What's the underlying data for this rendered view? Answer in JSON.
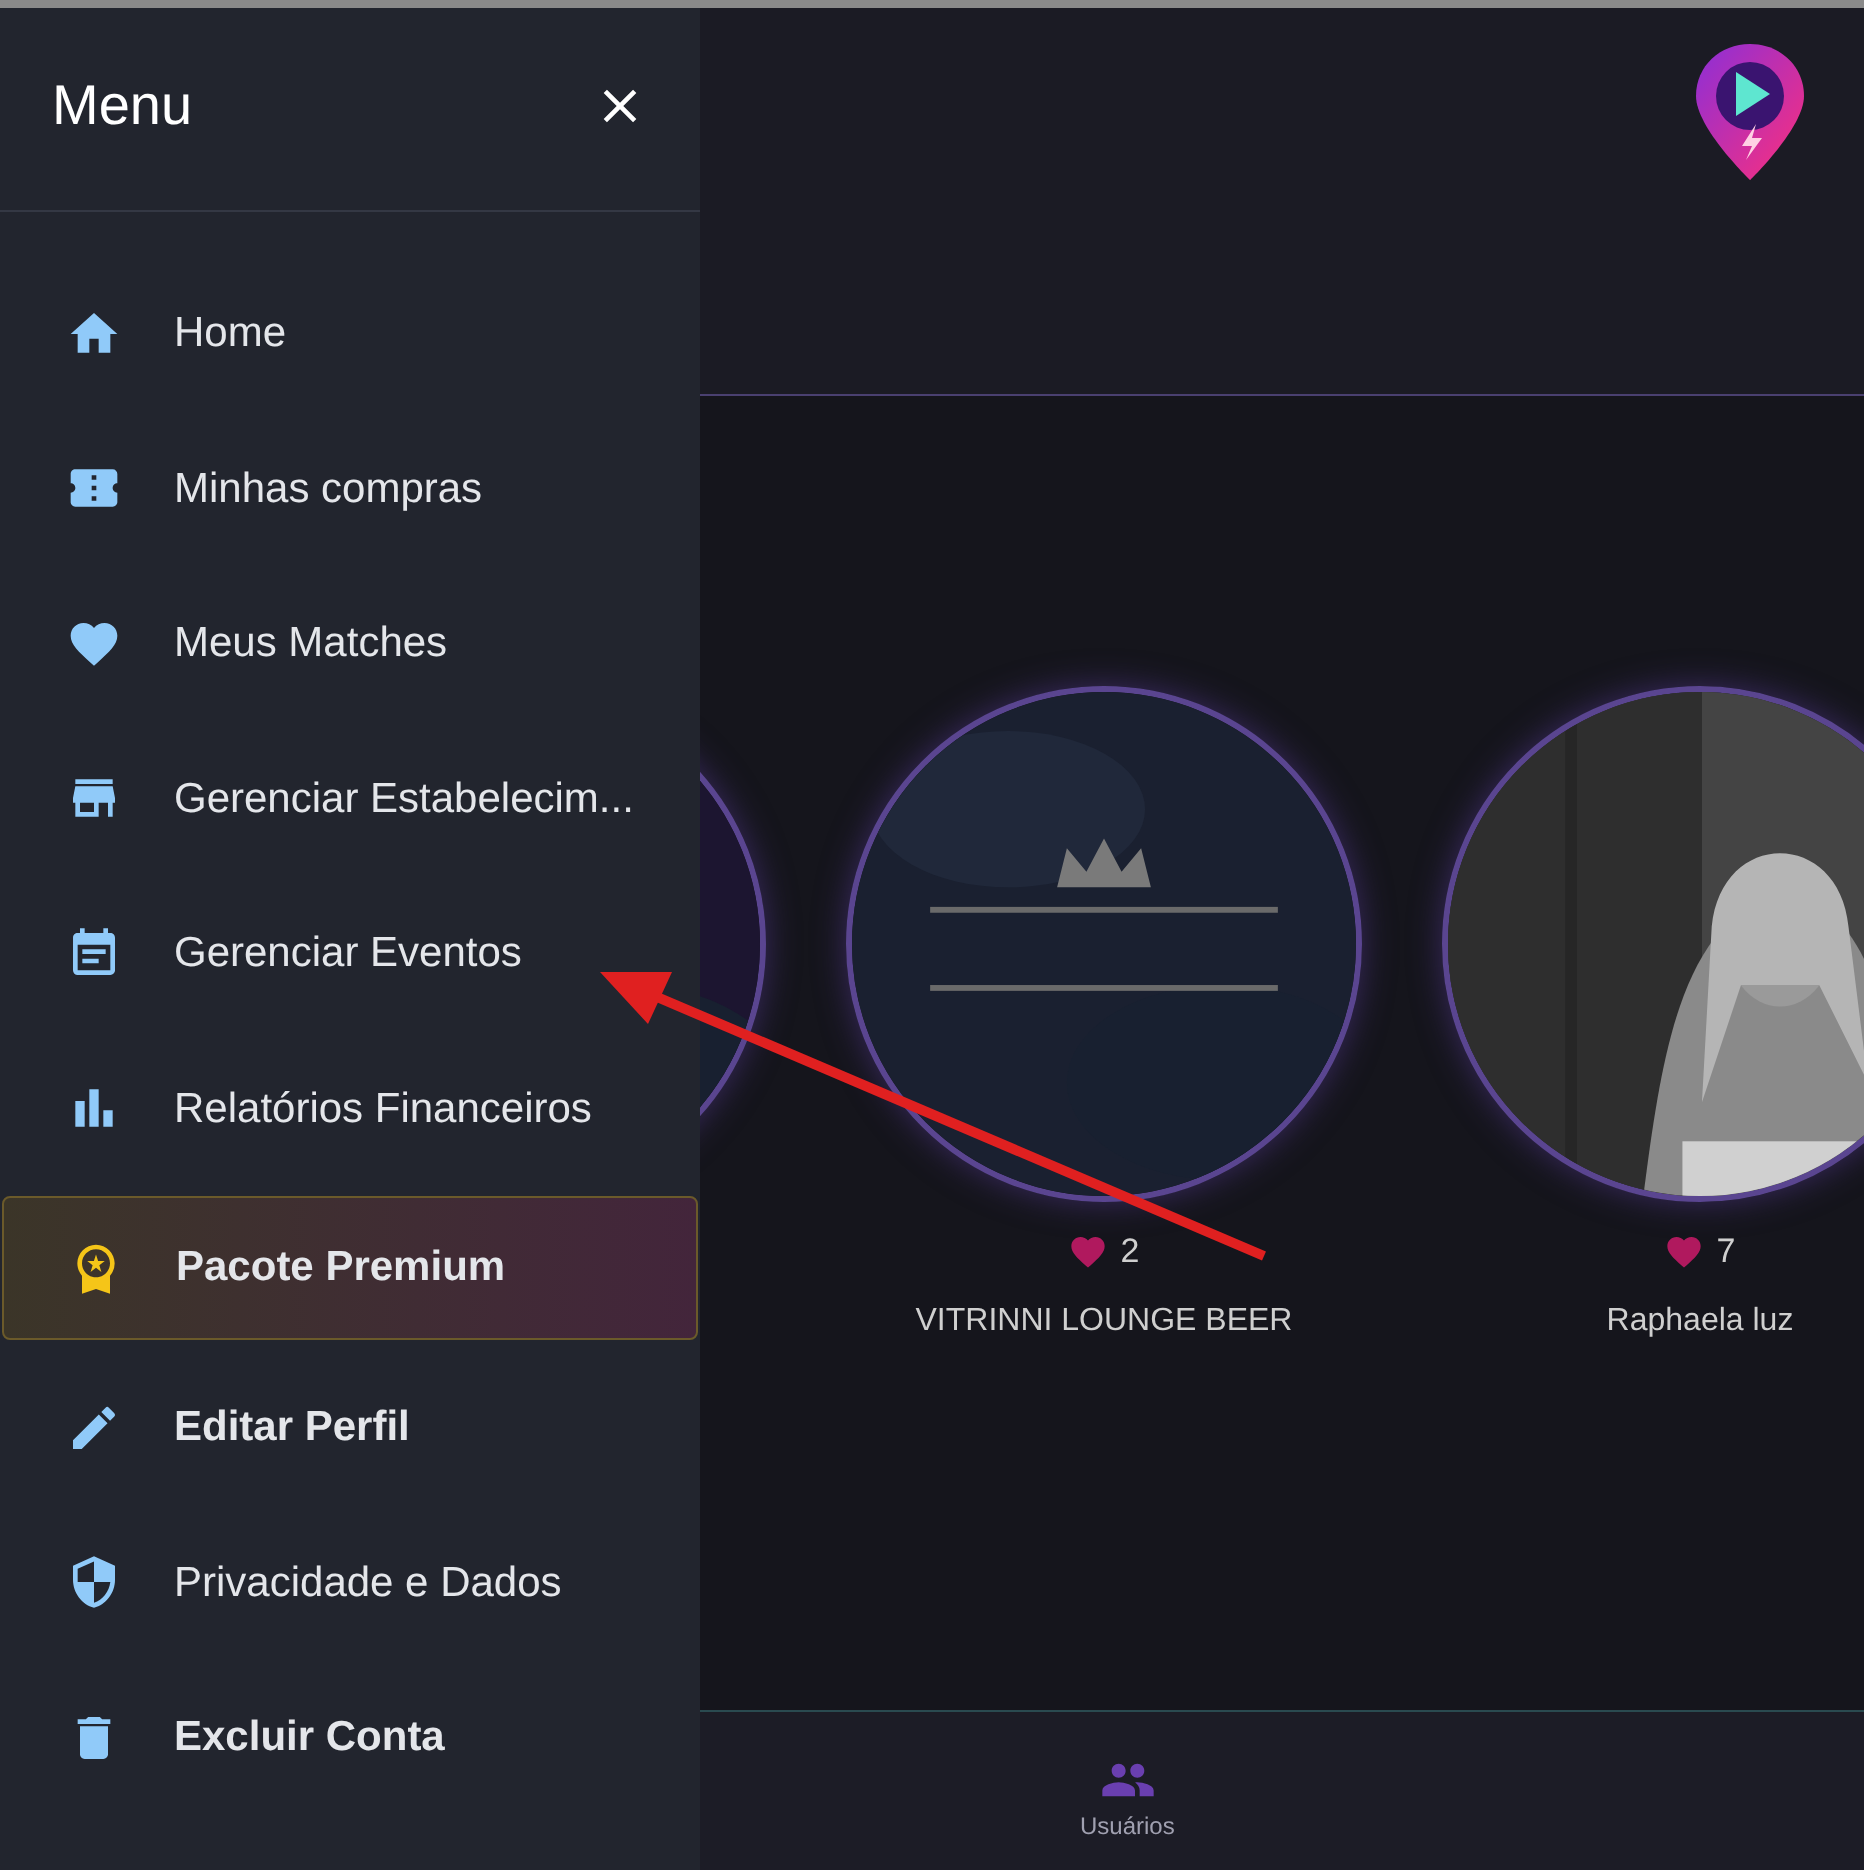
{
  "drawer": {
    "title": "Menu",
    "items": [
      {
        "label": "Home",
        "kind": "normal"
      },
      {
        "label": "Minhas compras",
        "kind": "normal"
      },
      {
        "label": "Meus Matches",
        "kind": "normal"
      },
      {
        "label": "Gerenciar Estabelecim...",
        "kind": "normal"
      },
      {
        "label": "Gerenciar Eventos",
        "kind": "normal"
      },
      {
        "label": "Relatórios Financeiros",
        "kind": "normal"
      },
      {
        "label": "Pacote Premium",
        "kind": "premium"
      },
      {
        "label": "Editar Perfil",
        "kind": "bold"
      },
      {
        "label": "Privacidade e Dados",
        "kind": "normal"
      },
      {
        "label": "Excluir Conta",
        "kind": "bold"
      }
    ]
  },
  "cards": [
    {
      "kind": "picture"
    },
    {
      "kind": "picture",
      "likes": "2",
      "name": "VITRINNI LOUNGE BEER"
    },
    {
      "kind": "picture",
      "likes": "7",
      "name": "Raphaela luz"
    }
  ],
  "bottom_nav": [
    {
      "label": "Usuários"
    }
  ]
}
